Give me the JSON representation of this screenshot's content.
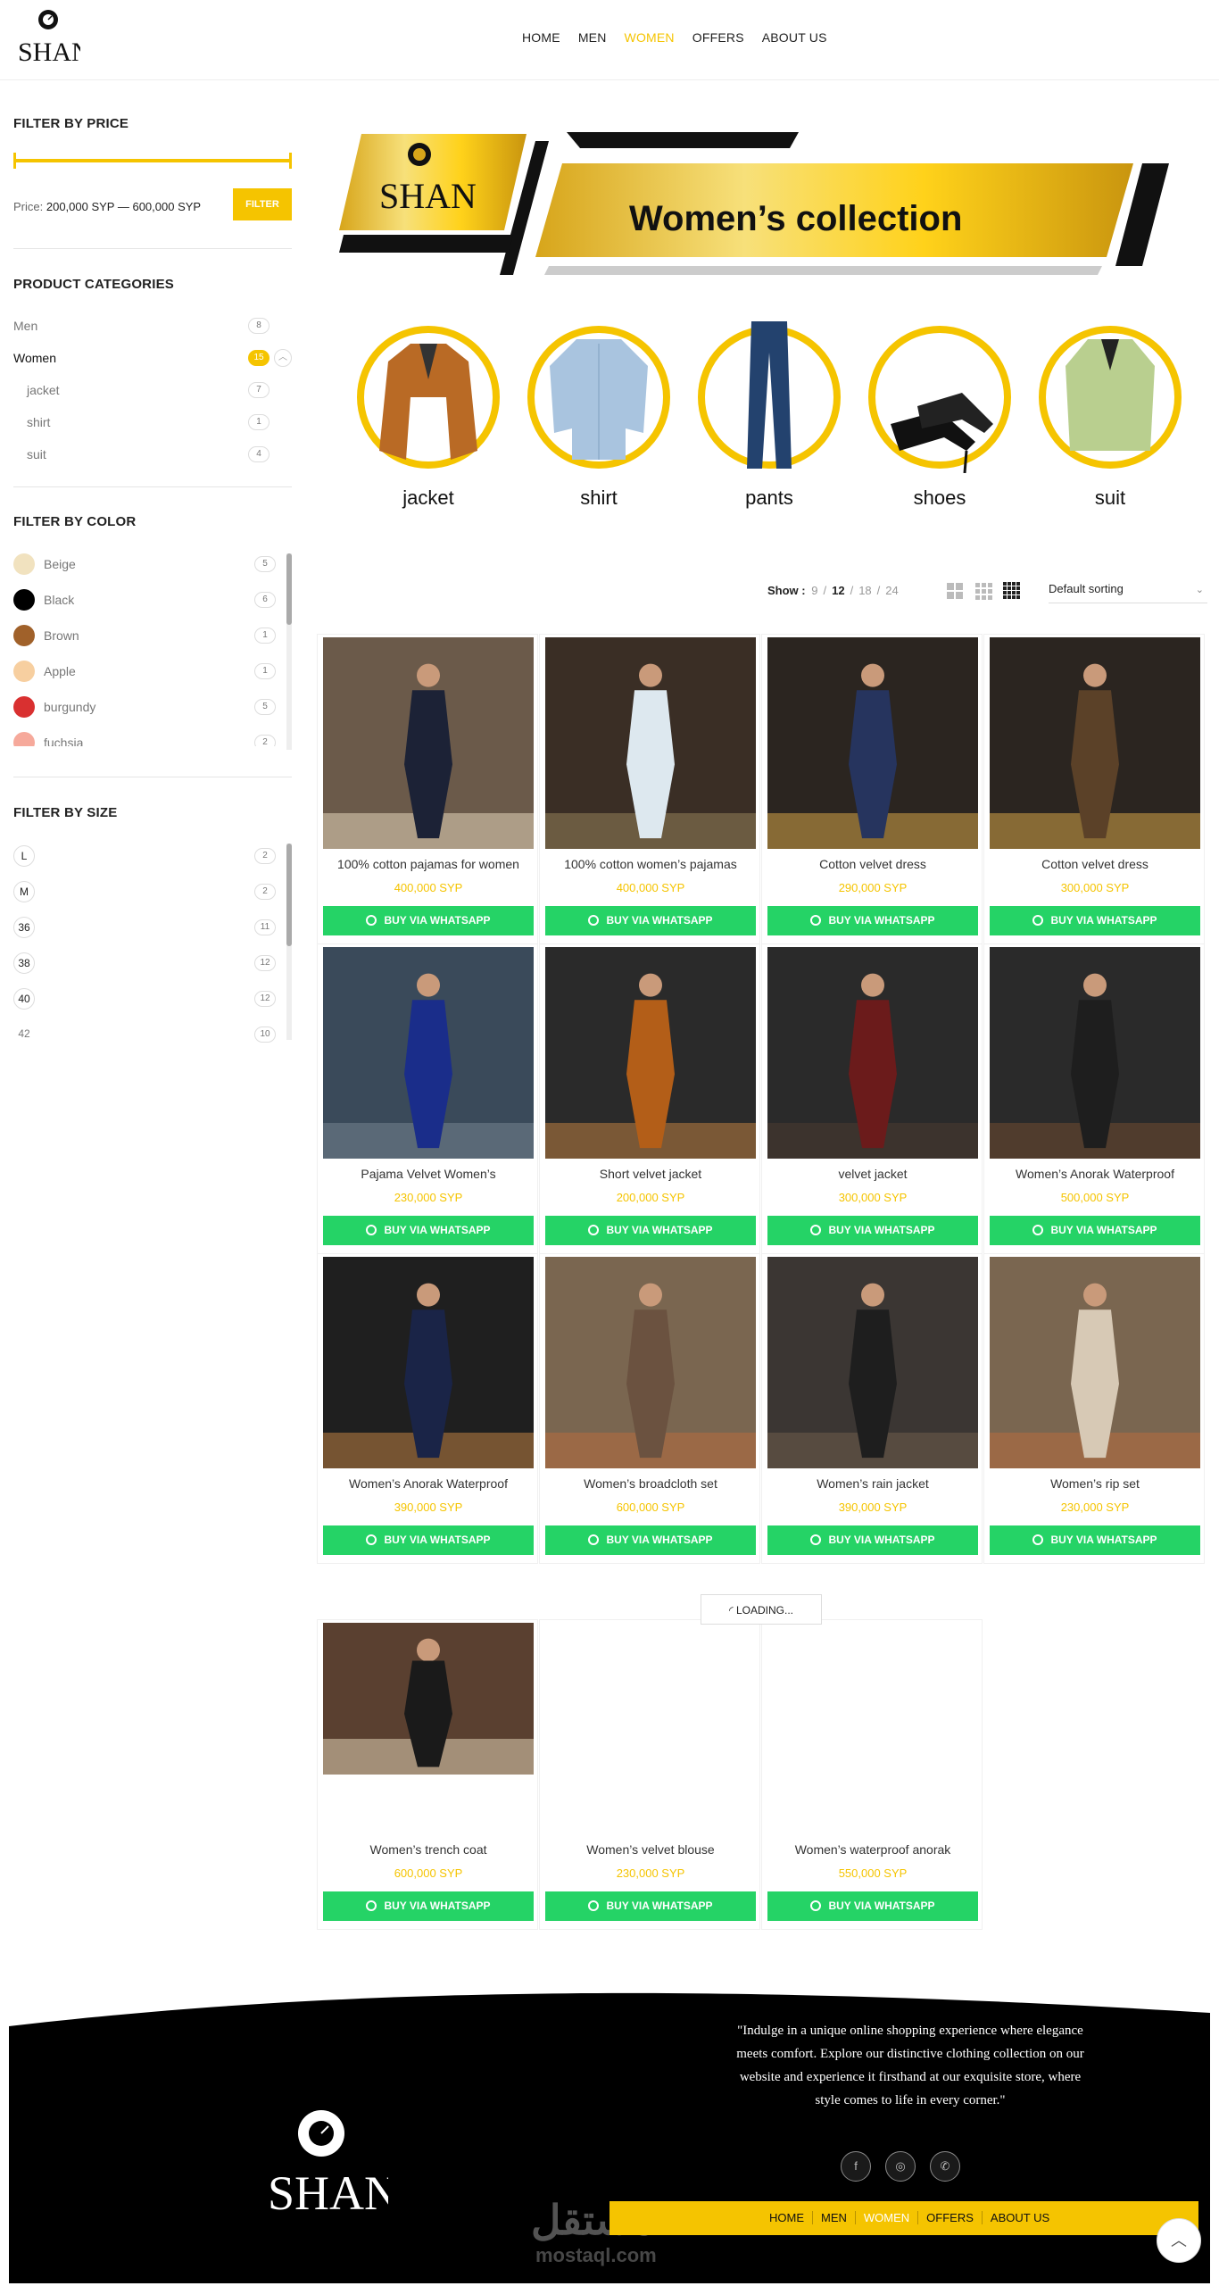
{
  "nav": {
    "items": [
      {
        "label": "HOME",
        "active": false
      },
      {
        "label": "MEN",
        "active": false
      },
      {
        "label": "WOMEN",
        "active": true
      },
      {
        "label": "OFFERS",
        "active": false
      },
      {
        "label": "ABOUT US",
        "active": false
      }
    ]
  },
  "brand": {
    "logo_text": "SHAN",
    "accent_color": "#f5c400",
    "whatsapp_color": "#25d366"
  },
  "sidebar": {
    "price": {
      "title": "FILTER BY PRICE",
      "label": "Price:",
      "range": "200,000 SYP — 600,000 SYP",
      "button": "FILTER"
    },
    "categories": {
      "title": "PRODUCT CATEGORIES",
      "items": [
        {
          "label": "Men",
          "count": "8",
          "active": false,
          "child": false
        },
        {
          "label": "Women",
          "count": "15",
          "active": true,
          "child": false
        },
        {
          "label": "jacket",
          "count": "7",
          "active": false,
          "child": true
        },
        {
          "label": "shirt",
          "count": "1",
          "active": false,
          "child": true
        },
        {
          "label": "suit",
          "count": "4",
          "active": false,
          "child": true
        }
      ]
    },
    "colors": {
      "title": "FILTER BY COLOR",
      "items": [
        {
          "label": "Beige",
          "count": "5",
          "swatch": "#f1e2bf"
        },
        {
          "label": "Black",
          "count": "6",
          "swatch": "#000000"
        },
        {
          "label": "Brown",
          "count": "1",
          "swatch": "#a0612a"
        },
        {
          "label": "Apple",
          "count": "1",
          "swatch": "#f7cfa0"
        },
        {
          "label": "burgundy",
          "count": "5",
          "swatch": "#d93030"
        },
        {
          "label": "fuchsia",
          "count": "2",
          "swatch": "#f6a99b"
        }
      ]
    },
    "sizes": {
      "title": "FILTER BY SIZE",
      "items": [
        {
          "label": "L",
          "count": "2"
        },
        {
          "label": "M",
          "count": "2"
        },
        {
          "label": "36",
          "count": "11"
        },
        {
          "label": "38",
          "count": "12"
        },
        {
          "label": "40",
          "count": "12"
        },
        {
          "label": "42",
          "count": "10"
        }
      ]
    }
  },
  "banner": {
    "logo_text": "SHAN",
    "title": "Women’s collection"
  },
  "category_circles": [
    {
      "label": "jacket"
    },
    {
      "label": "shirt"
    },
    {
      "label": "pants"
    },
    {
      "label": "shoes"
    },
    {
      "label": "suit"
    }
  ],
  "toolbar": {
    "show_label": "Show :",
    "per_page": [
      "9",
      "12",
      "18",
      "24"
    ],
    "per_page_current": "12",
    "sort": "Default sorting"
  },
  "products": [
    {
      "name": "100% cotton pajamas for women",
      "price": "400,000 SYP",
      "button": "BUY VIA WHATSAPP"
    },
    {
      "name": "100% cotton women’s pajamas",
      "price": "400,000 SYP",
      "button": "BUY VIA WHATSAPP"
    },
    {
      "name": "Cotton velvet dress",
      "price": "290,000 SYP",
      "button": "BUY VIA WHATSAPP"
    },
    {
      "name": "Cotton velvet dress",
      "price": "300,000 SYP",
      "button": "BUY VIA WHATSAPP"
    },
    {
      "name": "Pajama Velvet Women’s",
      "price": "230,000 SYP",
      "button": "BUY VIA WHATSAPP"
    },
    {
      "name": "Short velvet jacket",
      "price": "200,000 SYP",
      "button": "BUY VIA WHATSAPP"
    },
    {
      "name": "velvet jacket",
      "price": "300,000 SYP",
      "button": "BUY VIA WHATSAPP"
    },
    {
      "name": "Women’s Anorak Waterproof",
      "price": "500,000 SYP",
      "button": "BUY VIA WHATSAPP"
    },
    {
      "name": "Women’s Anorak Waterproof",
      "price": "390,000 SYP",
      "button": "BUY VIA WHATSAPP"
    },
    {
      "name": "Women’s broadcloth set",
      "price": "600,000 SYP",
      "button": "BUY VIA WHATSAPP"
    },
    {
      "name": "Women’s rain jacket",
      "price": "390,000 SYP",
      "button": "BUY VIA WHATSAPP"
    },
    {
      "name": "Women’s rip set",
      "price": "230,000 SYP",
      "button": "BUY VIA WHATSAPP"
    },
    {
      "name": "Women’s trench coat",
      "price": "600,000 SYP",
      "button": "BUY VIA WHATSAPP"
    },
    {
      "name": "Women’s velvet blouse",
      "price": "230,000 SYP",
      "button": "BUY VIA WHATSAPP"
    },
    {
      "name": "Women’s waterproof anorak",
      "price": "550,000 SYP",
      "button": "BUY VIA WHATSAPP"
    }
  ],
  "loading": {
    "label": "LOADING..."
  },
  "footer": {
    "quote": "\"Indulge in a unique online shopping experience where elegance meets comfort. Explore our distinctive clothing collection on our website and experience it firsthand at our exquisite store, where style comes to life in every corner.\"",
    "social": [
      {
        "icon": "facebook-icon",
        "glyph": "f"
      },
      {
        "icon": "instagram-icon",
        "glyph": "◎"
      },
      {
        "icon": "whatsapp-icon",
        "glyph": "✆"
      }
    ],
    "nav": [
      {
        "label": "HOME",
        "active": false
      },
      {
        "label": "MEN",
        "active": false
      },
      {
        "label": "WOMEN",
        "active": true
      },
      {
        "label": "OFFERS",
        "active": false
      },
      {
        "label": "ABOUT US",
        "active": false
      }
    ],
    "logo_text": "SHAN",
    "watermark_ar": "مستقل",
    "watermark_en": "mostaql.com"
  }
}
